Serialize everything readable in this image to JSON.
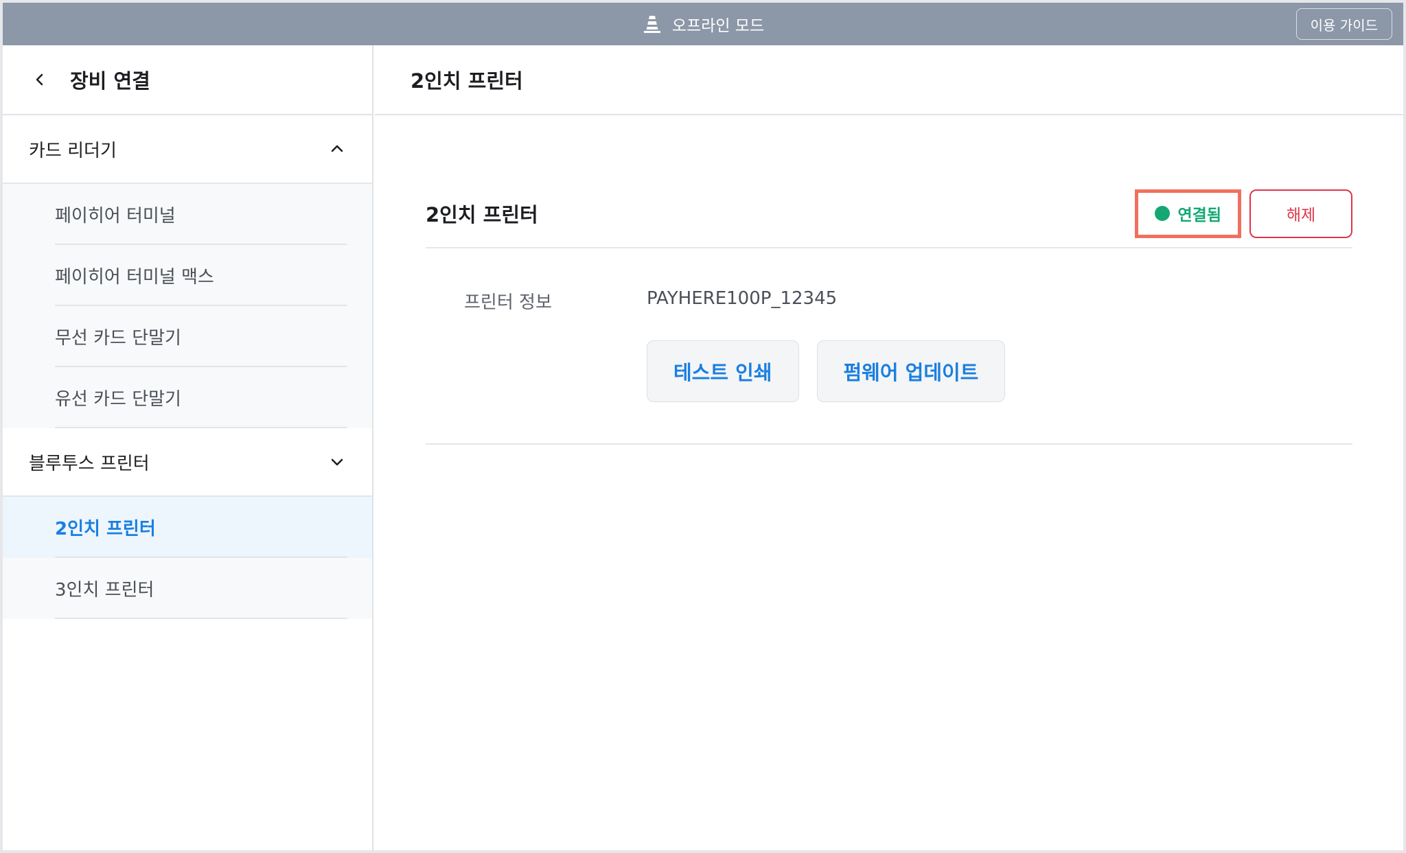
{
  "topbar": {
    "mode_label": "오프라인 모드",
    "mode_icon": "traffic-cone-icon",
    "guide_label": "이용 가이드"
  },
  "sidebar": {
    "title": "장비 연결",
    "back_icon": "chevron-left-icon",
    "groups": [
      {
        "label": "카드 리더기",
        "expanded": true,
        "items": [
          {
            "label": "페이히어 터미널"
          },
          {
            "label": "페이히어 터미널 맥스"
          },
          {
            "label": "무선 카드 단말기"
          },
          {
            "label": "유선 카드 단말기"
          }
        ]
      },
      {
        "label": "블루투스 프린터",
        "expanded": false,
        "items": [
          {
            "label": "2인치 프린터",
            "active": true
          },
          {
            "label": "3인치 프린터"
          }
        ]
      }
    ]
  },
  "main": {
    "title": "2인치 프린터",
    "device": {
      "name": "2인치 프린터",
      "status": "연결됨",
      "status_color": "#14a773",
      "disconnect_label": "해제",
      "info_label": "프린터 정보",
      "info_value": "PAYHERE100P_12345",
      "test_print_label": "테스트 인쇄",
      "firmware_label": "펌웨어 업데이트"
    }
  },
  "colors": {
    "topbar": "#8c97a8",
    "accent": "#1a7fe0",
    "danger": "#e0344a",
    "highlight": "#f0705f"
  }
}
